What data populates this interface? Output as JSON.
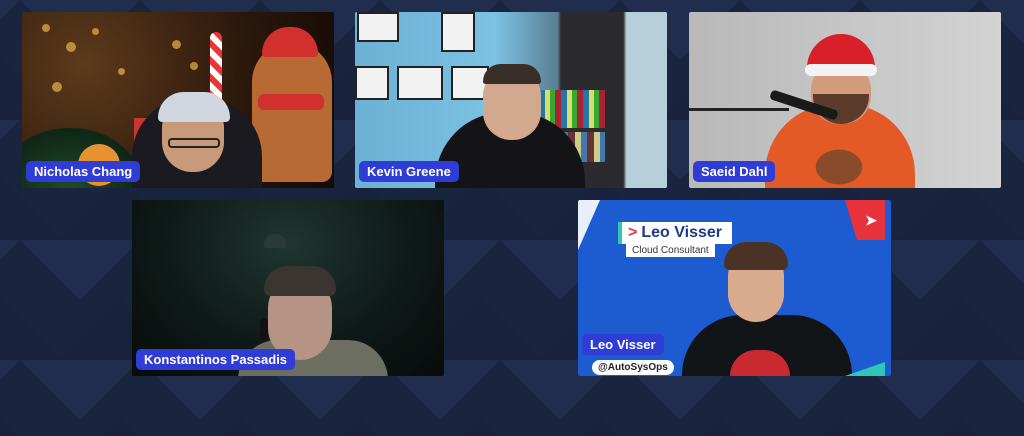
{
  "meeting": {
    "participants": [
      {
        "name": "Nicholas Chang"
      },
      {
        "name": "Kevin Greene"
      },
      {
        "name": "Saeid Dahl"
      },
      {
        "name": "Konstantinos Passadis"
      },
      {
        "name": "Leo Visser"
      }
    ],
    "overlay": {
      "title": "Leo Visser",
      "subtitle": "Cloud Consultant",
      "handle": "@AutoSysOps"
    }
  },
  "colors": {
    "background": "#16213b",
    "name_badge": "#2f3cd6",
    "overlay_accent": "#e8333d",
    "overlay_teal": "#2fc6b6"
  }
}
